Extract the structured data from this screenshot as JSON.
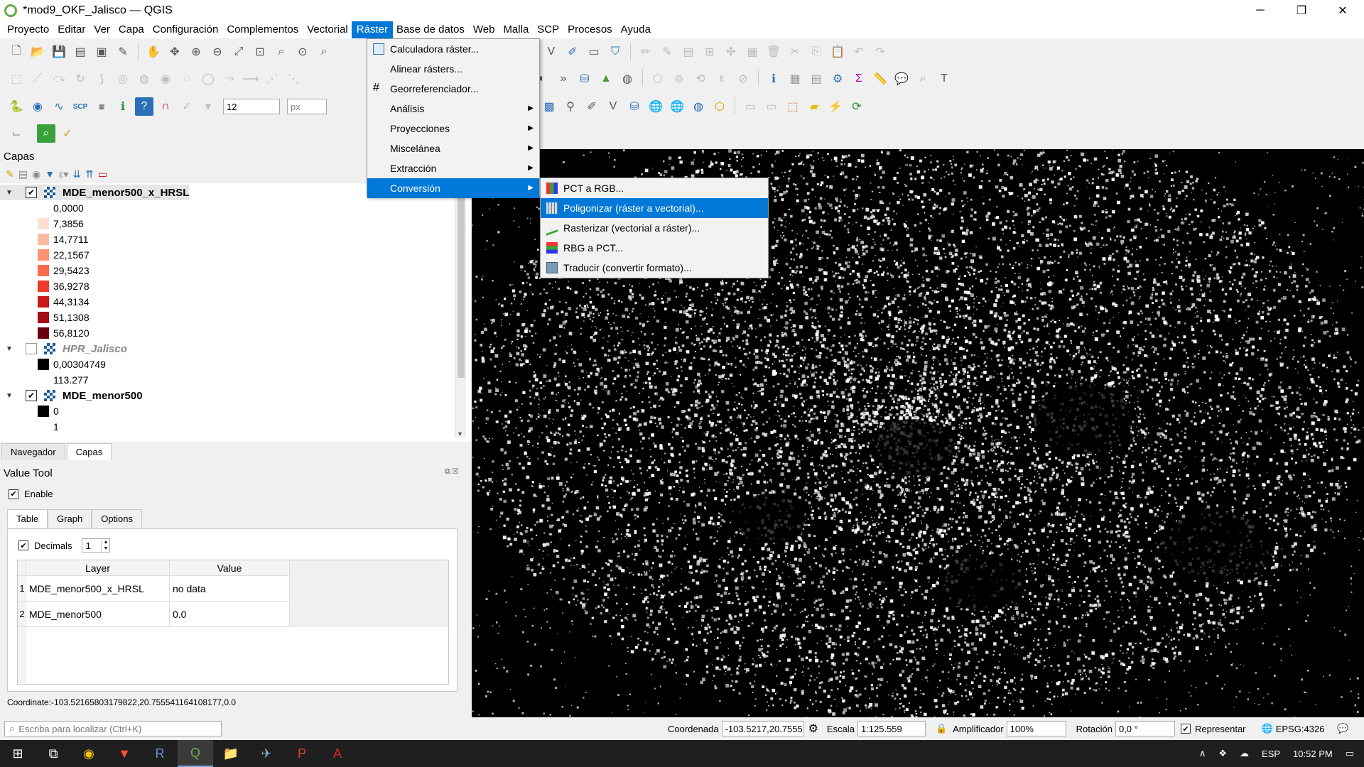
{
  "window": {
    "title": "*mod9_OKF_Jalisco — QGIS",
    "minimize": "─",
    "maximize": "❐",
    "close": "✕"
  },
  "menubar": [
    "Proyecto",
    "Editar",
    "Ver",
    "Capa",
    "Configuración",
    "Complementos",
    "Vectorial",
    "Ráster",
    "Base de datos",
    "Web",
    "Malla",
    "SCP",
    "Procesos",
    "Ayuda"
  ],
  "toolbar": {
    "size_value": "12",
    "unit_value": "px"
  },
  "layers_panel": {
    "title": "Capas",
    "layers": [
      {
        "name": "MDE_menor500_x_HRSL",
        "checked": true,
        "style": "bold",
        "legend": [
          {
            "label": "0,0000",
            "color": "#ffffff"
          },
          {
            "label": "7,3856",
            "color": "#fee0d2"
          },
          {
            "label": "14,7711",
            "color": "#fcbba1"
          },
          {
            "label": "22,1567",
            "color": "#fc9272"
          },
          {
            "label": "29,5423",
            "color": "#fb6a4a"
          },
          {
            "label": "36,9278",
            "color": "#ef3b2c"
          },
          {
            "label": "44,3134",
            "color": "#cb181d"
          },
          {
            "label": "51,1308",
            "color": "#a50f15"
          },
          {
            "label": "56,8120",
            "color": "#67000d"
          }
        ]
      },
      {
        "name": "HPR_Jalisco",
        "checked": false,
        "style": "italic",
        "legend": [
          {
            "label": "0,00304749",
            "color": "#000000"
          },
          {
            "label": "113.277",
            "color": "#ffffff"
          }
        ]
      },
      {
        "name": "MDE_menor500",
        "checked": true,
        "style": "bold",
        "legend": [
          {
            "label": "0",
            "color": "#000000"
          },
          {
            "label": "1",
            "color": "#ffffff"
          }
        ]
      }
    ]
  },
  "panel_tabs": [
    "Navegador",
    "Capas"
  ],
  "value_tool": {
    "title": "Value Tool",
    "enable_label": "Enable",
    "tabs": [
      "Table",
      "Graph",
      "Options"
    ],
    "decimals_label": "Decimals",
    "decimals_value": "1",
    "columns": [
      "Layer",
      "Value"
    ],
    "rows": [
      {
        "n": "1",
        "layer": "MDE_menor500_x_HRSL",
        "value": "no data"
      },
      {
        "n": "2",
        "layer": "MDE_menor500",
        "value": "0.0"
      }
    ],
    "coordinate": "Coordinate:-103.52165803179822,20.755541164108177,0.0"
  },
  "raster_menu": {
    "items": [
      {
        "label": "Calculadora ráster...",
        "icon": "calculator-icon",
        "submenu": false
      },
      {
        "label": "Alinear rásters...",
        "icon": "",
        "submenu": false
      },
      {
        "label": "Georreferenciador...",
        "icon": "grid-icon",
        "submenu": false
      },
      {
        "label": "Análisis",
        "icon": "",
        "submenu": true
      },
      {
        "label": "Proyecciones",
        "icon": "",
        "submenu": true
      },
      {
        "label": "Miscelánea",
        "icon": "",
        "submenu": true
      },
      {
        "label": "Extracción",
        "icon": "",
        "submenu": true
      },
      {
        "label": "Conversión",
        "icon": "",
        "submenu": true
      }
    ],
    "highlighted": "Conversión"
  },
  "conversion_menu": {
    "items": [
      {
        "label": "PCT a RGB...",
        "icon": "pct-rgb-icon"
      },
      {
        "label": "Poligonizar (ráster a vectorial)...",
        "icon": "polygonize-icon"
      },
      {
        "label": "Rasterizar (vectorial a ráster)...",
        "icon": "rasterize-icon"
      },
      {
        "label": "RBG a PCT...",
        "icon": "rgb-pct-icon"
      },
      {
        "label": "Traducir (convertir formato)...",
        "icon": "translate-icon"
      }
    ],
    "highlighted": "Poligonizar (ráster a vectorial)..."
  },
  "statusbar": {
    "search_placeholder": "Escriba para localizar (Ctrl+K)",
    "coord_label": "Coordenada",
    "coord_value": "-103.5217,20.7555",
    "scale_label": "Escala",
    "scale_value": "1:125.559",
    "magnifier_label": "Amplificador",
    "magnifier_value": "100%",
    "rotation_label": "Rotación",
    "rotation_value": "0,0 °",
    "render_label": "Representar",
    "crs": "EPSG:4326"
  },
  "taskbar": {
    "lang": "ESP",
    "time": "10:52 PM"
  }
}
